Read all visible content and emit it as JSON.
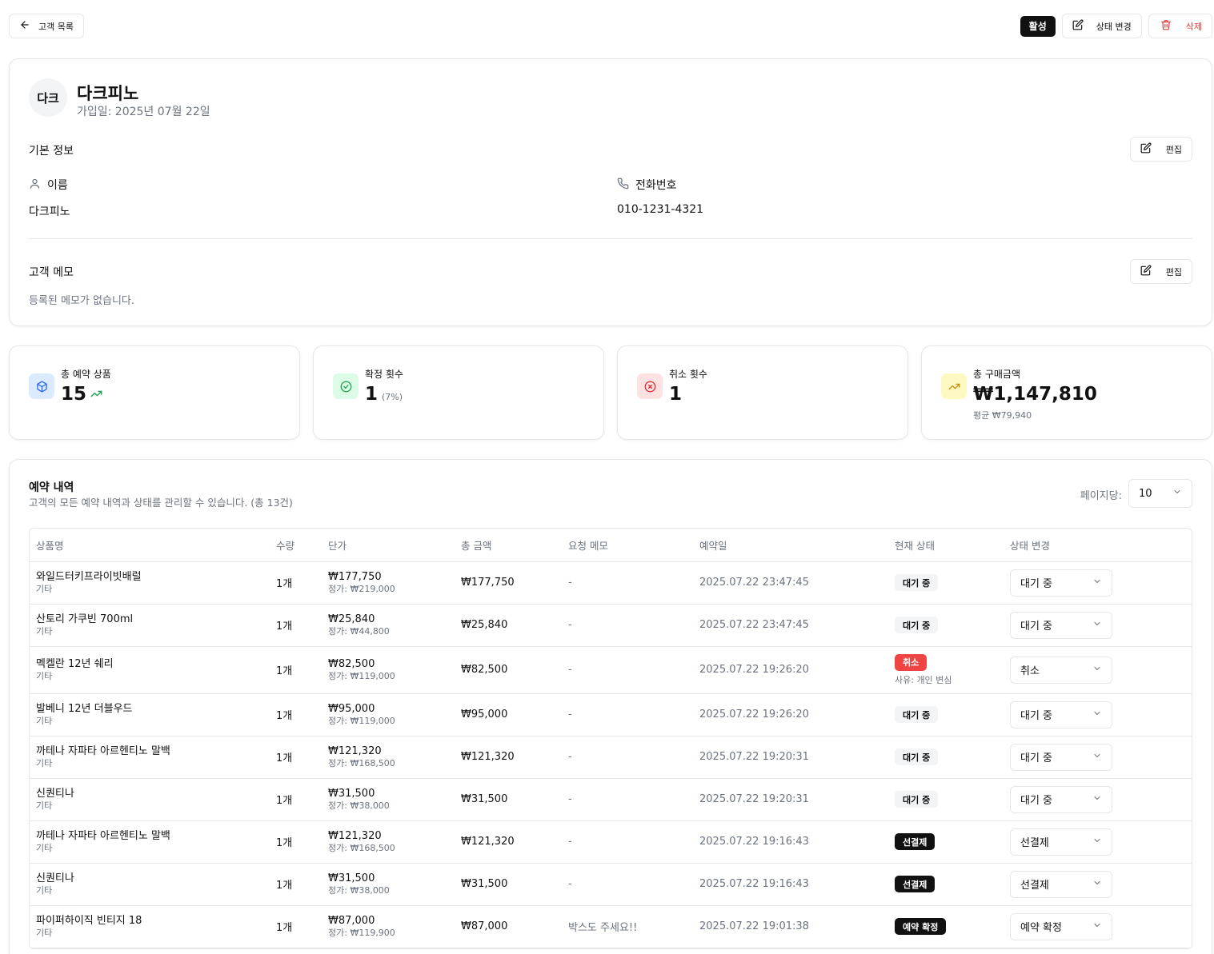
{
  "topbar": {
    "back_label": "고객 목록",
    "status_badge": "활성",
    "change_status_label": "상태 변경",
    "delete_label": "삭제"
  },
  "profile": {
    "avatar_text": "다크",
    "name": "다크피노",
    "join_date": "가입일: 2025년 07월 22일",
    "basic_info_title": "기본 정보",
    "edit_label": "편집",
    "name_label": "이름",
    "name_value": "다크피노",
    "phone_label": "전화번호",
    "phone_value": "010-1231-4321",
    "memo_title": "고객 메모",
    "memo_empty": "등록된 메모가 없습니다."
  },
  "stats": [
    {
      "label": "총 예약 상품",
      "value": "15",
      "sub": ""
    },
    {
      "label": "확정 횟수",
      "value": "1",
      "sub": "(7%)"
    },
    {
      "label": "취소 횟수",
      "value": "1",
      "sub": ""
    },
    {
      "label": "총 구매금액",
      "value": "₩1,147,810",
      "sub": "평균 ₩79,940"
    }
  ],
  "colors": {
    "accent_dark": "#111111",
    "danger": "#ef4444",
    "blue_bg": "#dbeafe",
    "green_bg": "#dcfce7",
    "red_bg": "#fee2e2",
    "yellow_bg": "#fef9c3"
  },
  "reservations": {
    "title": "예약 내역",
    "description": "고객의 모든 예약 내역과 상태를 관리할 수 있습니다. (총 13건)",
    "per_page_label": "페이지당:",
    "per_page_value": "10",
    "columns": [
      "상품명",
      "수량",
      "단가",
      "총 금액",
      "요청 메모",
      "예약일",
      "현재 상태",
      "상태 변경"
    ],
    "rows": [
      {
        "name": "와일드터키프라이빗배럴",
        "category": "기타",
        "qty": "1개",
        "price": "₩177,750",
        "regular": "정가: ₩219,000",
        "total": "₩177,750",
        "memo": "-",
        "date": "2025.07.22 23:47:45",
        "status": "대기 중",
        "status_type": "pending",
        "reason": "",
        "select": "대기 중"
      },
      {
        "name": "산토리 가쿠빈 700ml",
        "category": "기타",
        "qty": "1개",
        "price": "₩25,840",
        "regular": "정가: ₩44,800",
        "total": "₩25,840",
        "memo": "-",
        "date": "2025.07.22 23:47:45",
        "status": "대기 중",
        "status_type": "pending",
        "reason": "",
        "select": "대기 중"
      },
      {
        "name": "멕켈란 12년 쉐리",
        "category": "기타",
        "qty": "1개",
        "price": "₩82,500",
        "regular": "정가: ₩119,000",
        "total": "₩82,500",
        "memo": "-",
        "date": "2025.07.22 19:26:20",
        "status": "취소",
        "status_type": "cancel",
        "reason": "사유: 개인 변심",
        "select": "취소"
      },
      {
        "name": "발베니 12년 더블우드",
        "category": "기타",
        "qty": "1개",
        "price": "₩95,000",
        "regular": "정가: ₩119,000",
        "total": "₩95,000",
        "memo": "-",
        "date": "2025.07.22 19:26:20",
        "status": "대기 중",
        "status_type": "pending",
        "reason": "",
        "select": "대기 중"
      },
      {
        "name": "까테나 자파타 아르헨티노 말백",
        "category": "기타",
        "qty": "1개",
        "price": "₩121,320",
        "regular": "정가: ₩168,500",
        "total": "₩121,320",
        "memo": "-",
        "date": "2025.07.22 19:20:31",
        "status": "대기 중",
        "status_type": "pending",
        "reason": "",
        "select": "대기 중"
      },
      {
        "name": "신퀀티나",
        "category": "기타",
        "qty": "1개",
        "price": "₩31,500",
        "regular": "정가: ₩38,000",
        "total": "₩31,500",
        "memo": "-",
        "date": "2025.07.22 19:20:31",
        "status": "대기 중",
        "status_type": "pending",
        "reason": "",
        "select": "대기 중"
      },
      {
        "name": "까테나 자파타 아르헨티노 말백",
        "category": "기타",
        "qty": "1개",
        "price": "₩121,320",
        "regular": "정가: ₩168,500",
        "total": "₩121,320",
        "memo": "-",
        "date": "2025.07.22 19:16:43",
        "status": "선결제",
        "status_type": "dark",
        "reason": "",
        "select": "선결제"
      },
      {
        "name": "신퀀티나",
        "category": "기타",
        "qty": "1개",
        "price": "₩31,500",
        "regular": "정가: ₩38,000",
        "total": "₩31,500",
        "memo": "-",
        "date": "2025.07.22 19:16:43",
        "status": "선결제",
        "status_type": "dark",
        "reason": "",
        "select": "선결제"
      },
      {
        "name": "파이퍼하이직 빈티지 18",
        "category": "기타",
        "qty": "1개",
        "price": "₩87,000",
        "regular": "정가: ₩119,900",
        "total": "₩87,000",
        "memo": "박스도 주세요!!",
        "date": "2025.07.22 19:01:38",
        "status": "예약 확정",
        "status_type": "dark",
        "reason": "",
        "select": "예약 확정"
      }
    ]
  }
}
